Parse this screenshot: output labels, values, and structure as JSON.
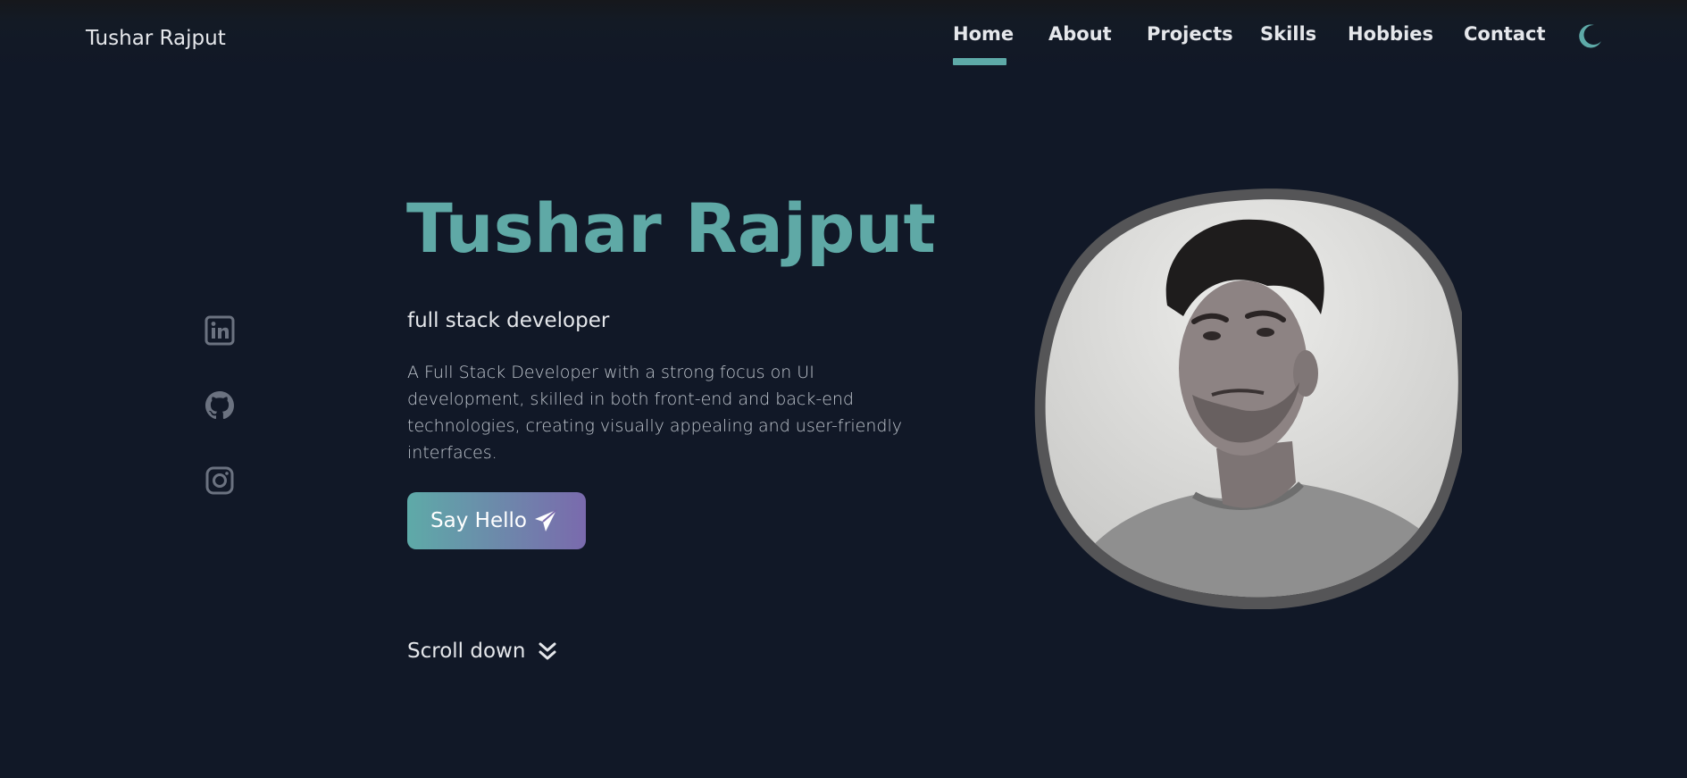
{
  "header": {
    "brand": "Tushar Rajput",
    "nav": [
      "Home",
      "About",
      "Projects",
      "Skills",
      "Hobbies",
      "Contact"
    ],
    "active_nav": "Home",
    "theme_icon": "moon-icon"
  },
  "social": {
    "icons": [
      "linkedin-icon",
      "github-icon",
      "instagram-icon"
    ]
  },
  "hero": {
    "title": "Tushar Rajput",
    "subtitle": "full stack developer",
    "description": "A Full Stack Developer with a strong focus on UI development, skilled in both front-end and back-end technologies, creating visually appealing and user-friendly interfaces.",
    "cta_label": "Say Hello",
    "cta_icon": "send-icon",
    "scroll_label": "Scroll down",
    "scroll_icon": "chevrons-down-icon"
  },
  "colors": {
    "background": "#111827",
    "accent": "#5eaaa8",
    "accent_secondary": "#7a6aad",
    "text": "#e5e7eb"
  }
}
